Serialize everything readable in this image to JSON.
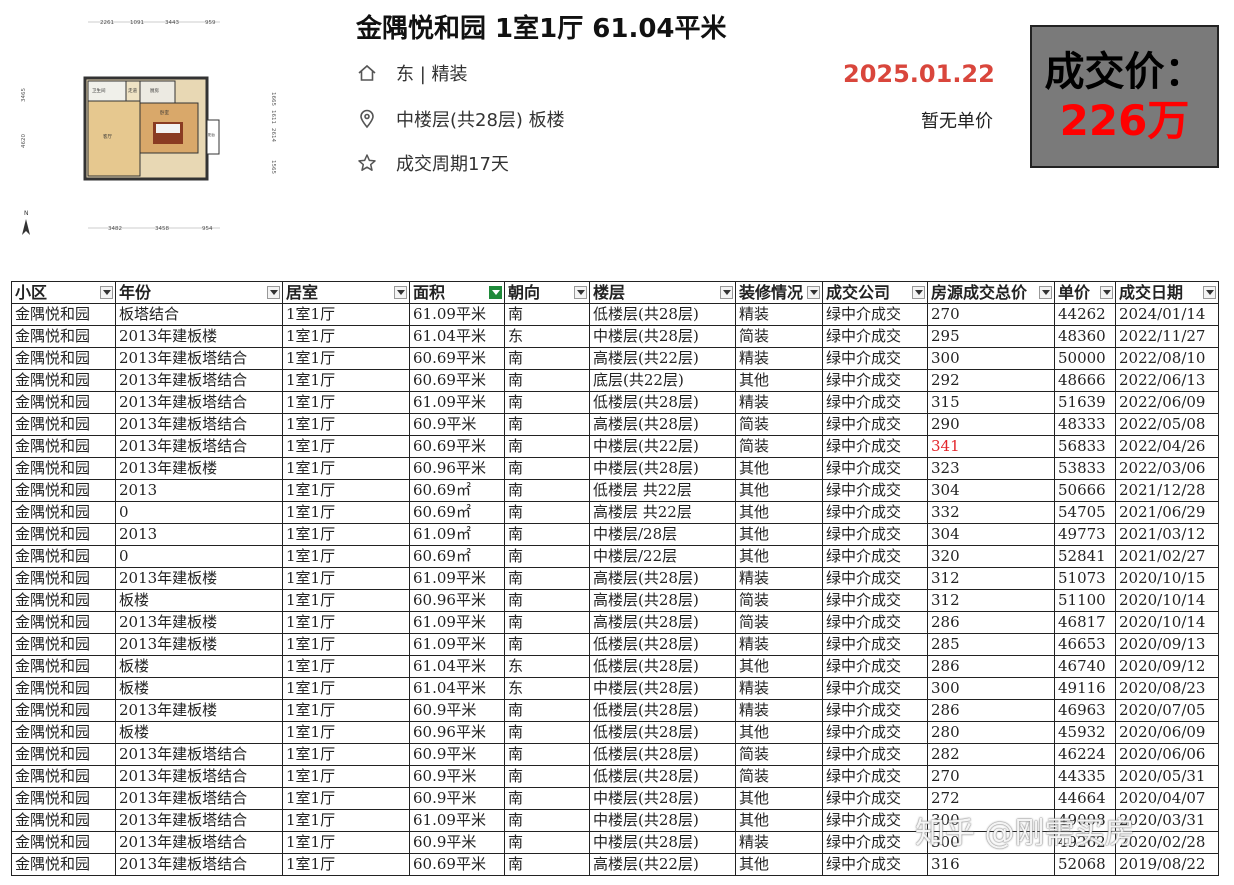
{
  "listing": {
    "title": "金隅悦和园 1室1厅 61.04平米",
    "orientation_decoration": "东 | 精装",
    "floor_info": "中楼层(共28层) 板楼",
    "deal_cycle": "成交周期17天",
    "deal_date": "2025.01.22",
    "unit_price": "暂无单价",
    "price_label": "成交价：",
    "price_value": "226万"
  },
  "floorplan": {
    "dims_top": [
      "2261",
      "1091",
      "3443",
      "959"
    ],
    "dims_bottom": [
      "3482",
      "3458",
      "954"
    ],
    "dims_left": [
      "3465",
      "4620"
    ],
    "dims_right": [
      "1665",
      "1611",
      "2614",
      "1565"
    ],
    "rooms": [
      "卫生间",
      "厨房",
      "客厅",
      "卧室",
      "阳台",
      "走道"
    ],
    "north": "N"
  },
  "table": {
    "headers": [
      "小区",
      "年份",
      "居室",
      "面积",
      "朝向",
      "楼层",
      "装修情况",
      "成交公司",
      "房源成交总价",
      "单价",
      "成交日期"
    ],
    "rows": [
      [
        "金隅悦和园",
        "板塔结合",
        "1室1厅",
        "61.09平米",
        "南",
        "低楼层(共28层)",
        "精装",
        "绿中介成交",
        "270",
        "44262",
        "2024/01/14"
      ],
      [
        "金隅悦和园",
        "2013年建板楼",
        "1室1厅",
        "61.04平米",
        "东",
        "中楼层(共28层)",
        "简装",
        "绿中介成交",
        "295",
        "48360",
        "2022/11/27"
      ],
      [
        "金隅悦和园",
        "2013年建板塔结合",
        "1室1厅",
        "60.69平米",
        "南",
        "高楼层(共22层)",
        "精装",
        "绿中介成交",
        "300",
        "50000",
        "2022/08/10"
      ],
      [
        "金隅悦和园",
        "2013年建板塔结合",
        "1室1厅",
        "60.69平米",
        "南",
        "底层(共22层)",
        "其他",
        "绿中介成交",
        "292",
        "48666",
        "2022/06/13"
      ],
      [
        "金隅悦和园",
        "2013年建板塔结合",
        "1室1厅",
        "61.09平米",
        "南",
        "低楼层(共28层)",
        "精装",
        "绿中介成交",
        "315",
        "51639",
        "2022/06/09"
      ],
      [
        "金隅悦和园",
        "2013年建板塔结合",
        "1室1厅",
        "60.9平米",
        "南",
        "高楼层(共28层)",
        "简装",
        "绿中介成交",
        "290",
        "48333",
        "2022/05/08"
      ],
      [
        "金隅悦和园",
        "2013年建板塔结合",
        "1室1厅",
        "60.69平米",
        "南",
        "中楼层(共22层)",
        "简装",
        "绿中介成交",
        "341",
        "56833",
        "2022/04/26"
      ],
      [
        "金隅悦和园",
        "2013年建板楼",
        "1室1厅",
        "60.96平米",
        "南",
        "中楼层(共28层)",
        "其他",
        "绿中介成交",
        "323",
        "53833",
        "2022/03/06"
      ],
      [
        "金隅悦和园",
        "2013",
        "1室1厅",
        "60.69㎡",
        "南",
        "低楼层 共22层",
        "其他",
        "绿中介成交",
        "304",
        "50666",
        "2021/12/28"
      ],
      [
        "金隅悦和园",
        "0",
        "1室1厅",
        "60.69㎡",
        "南",
        "高楼层 共22层",
        "其他",
        "绿中介成交",
        "332",
        "54705",
        "2021/06/29"
      ],
      [
        "金隅悦和园",
        "2013",
        "1室1厅",
        "61.09㎡",
        "南",
        "中楼层/28层",
        "其他",
        "绿中介成交",
        "304",
        "49773",
        "2021/03/12"
      ],
      [
        "金隅悦和园",
        "0",
        "1室1厅",
        "60.69㎡",
        "南",
        "中楼层/22层",
        "其他",
        "绿中介成交",
        "320",
        "52841",
        "2021/02/27"
      ],
      [
        "金隅悦和园",
        "2013年建板楼",
        "1室1厅",
        "61.09平米",
        "南",
        "高楼层(共28层)",
        "精装",
        "绿中介成交",
        "312",
        "51073",
        "2020/10/15"
      ],
      [
        "金隅悦和园",
        "板楼",
        "1室1厅",
        "60.96平米",
        "南",
        "高楼层(共28层)",
        "简装",
        "绿中介成交",
        "312",
        "51100",
        "2020/10/14"
      ],
      [
        "金隅悦和园",
        "2013年建板楼",
        "1室1厅",
        "61.09平米",
        "南",
        "高楼层(共28层)",
        "简装",
        "绿中介成交",
        "286",
        "46817",
        "2020/10/14"
      ],
      [
        "金隅悦和园",
        "2013年建板楼",
        "1室1厅",
        "61.09平米",
        "南",
        "低楼层(共28层)",
        "精装",
        "绿中介成交",
        "285",
        "46653",
        "2020/09/13"
      ],
      [
        "金隅悦和园",
        "板楼",
        "1室1厅",
        "61.04平米",
        "东",
        "低楼层(共28层)",
        "其他",
        "绿中介成交",
        "286",
        "46740",
        "2020/09/12"
      ],
      [
        "金隅悦和园",
        "板楼",
        "1室1厅",
        "61.04平米",
        "东",
        "中楼层(共28层)",
        "精装",
        "绿中介成交",
        "300",
        "49116",
        "2020/08/23"
      ],
      [
        "金隅悦和园",
        "2013年建板楼",
        "1室1厅",
        "60.9平米",
        "南",
        "低楼层(共28层)",
        "精装",
        "绿中介成交",
        "286",
        "46963",
        "2020/07/05"
      ],
      [
        "金隅悦和园",
        "板楼",
        "1室1厅",
        "60.96平米",
        "南",
        "低楼层(共28层)",
        "其他",
        "绿中介成交",
        "280",
        "45932",
        "2020/06/09"
      ],
      [
        "金隅悦和园",
        "2013年建板塔结合",
        "1室1厅",
        "60.9平米",
        "南",
        "低楼层(共28层)",
        "简装",
        "绿中介成交",
        "282",
        "46224",
        "2020/06/06"
      ],
      [
        "金隅悦和园",
        "2013年建板塔结合",
        "1室1厅",
        "60.9平米",
        "南",
        "低楼层(共28层)",
        "简装",
        "绿中介成交",
        "270",
        "44335",
        "2020/05/31"
      ],
      [
        "金隅悦和园",
        "2013年建板塔结合",
        "1室1厅",
        "60.9平米",
        "南",
        "中楼层(共28层)",
        "其他",
        "绿中介成交",
        "272",
        "44664",
        "2020/04/07"
      ],
      [
        "金隅悦和园",
        "2013年建板塔结合",
        "1室1厅",
        "61.09平米",
        "南",
        "中楼层(共28层)",
        "其他",
        "绿中介成交",
        "300",
        "49098",
        "2020/03/31"
      ],
      [
        "金隅悦和园",
        "2013年建板塔结合",
        "1室1厅",
        "60.9平米",
        "南",
        "中楼层(共28层)",
        "精装",
        "绿中介成交",
        "300",
        "49262",
        "2020/02/28"
      ],
      [
        "金隅悦和园",
        "2013年建板塔结合",
        "1室1厅",
        "60.69平米",
        "南",
        "高楼层(共22层)",
        "其他",
        "绿中介成交",
        "316",
        "52068",
        "2019/08/22"
      ]
    ],
    "highlight": {
      "row": 6,
      "col": 8,
      "color": "#e3262c"
    },
    "filtered_column": 3
  },
  "watermark": "知乎 @刚需买房",
  "colors": {
    "date_red": "#d9463c",
    "price_box_bg": "#7a7a7a",
    "price_red": "#ff0000",
    "filter_green": "#1f8a3a"
  }
}
